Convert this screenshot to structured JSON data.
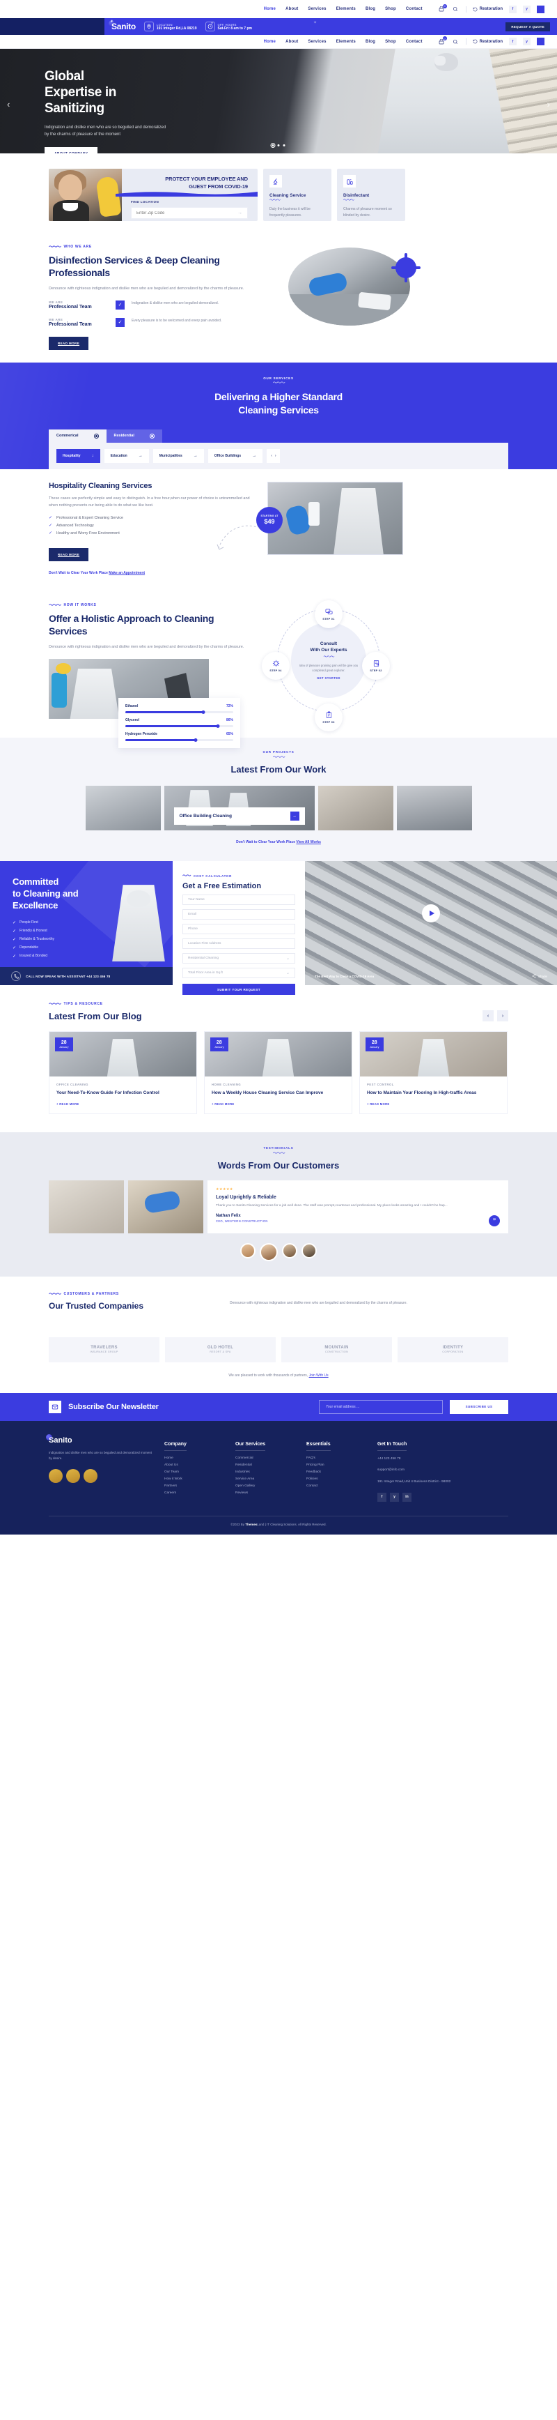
{
  "topbar": {
    "nav": [
      "Home",
      "About",
      "Services",
      "Elements",
      "Blog",
      "Shop",
      "Contact"
    ],
    "active_nav": "Home",
    "cart_badge": "0",
    "restoration_label": "Restoration",
    "socials": [
      "f",
      "y",
      "o"
    ]
  },
  "header": {
    "brand": "Sanito",
    "location_label": "LOCATION",
    "location_value": "191 Integer Rd,LA 08219",
    "hours_label": "OFF. HOURS",
    "hours_value": "Sat-Fri: 8 am to 7 pm",
    "quote_button": "REQUEST A QUOTE"
  },
  "hero": {
    "title_line1": "Global",
    "title_line2": "Expertise in",
    "title_line3": "Sanitizing",
    "description": "Indignation and dislike men who are so beguiled and demoralized by the charms of pleasure of the moment",
    "button": "ABOUT COMPANY",
    "slide_count": 3,
    "active_slide": 1
  },
  "promo": {
    "headline_line1": "PROTECT YOUR EMPLOYEE AND",
    "headline_line2": "GUEST FROM COVID-19",
    "find_label": "FIND LOCATION",
    "zip_placeholder": "Enter Zip Code",
    "zip_value": "",
    "cards": [
      {
        "title": "Cleaning Service",
        "desc": "Duty the business it will be frequently pleasures.",
        "icon": "broom-icon"
      },
      {
        "title": "Disinfectant",
        "desc": "Charms of pleasure moment so blinded by desire.",
        "icon": "spray-icon"
      }
    ]
  },
  "who": {
    "eyebrow": "WHO WE ARE",
    "title": "Disinfection Services & Deep Cleaning Professionals",
    "description": "Denounce with righteous indignation and dislike men who are beguiled and demoralized by the charms of pleasure.",
    "features": [
      {
        "label": "WE ARE",
        "value": "Professional Team",
        "text": "Indignation & dislike men who are beguiled demoralized."
      },
      {
        "label": "WE ARE",
        "value": "Professional Team",
        "text": "Every pleasure is to be welcomed and every pain avoided."
      }
    ],
    "button": "READ MORE"
  },
  "services": {
    "eyebrow": "OUR SERVICES",
    "title_line1": "Delivering a Higher Standard",
    "title_line2": "Cleaning Services",
    "tabs": [
      {
        "label": "Commerical",
        "active": true
      },
      {
        "label": "Residential",
        "active": false
      }
    ],
    "categories": [
      {
        "label": "Hospitality",
        "active": true,
        "arrow": "↓"
      },
      {
        "label": "Education",
        "active": false,
        "arrow": "→"
      },
      {
        "label": "Municipalities",
        "active": false,
        "arrow": "→"
      },
      {
        "label": "Office Buildings",
        "active": false,
        "arrow": "→"
      }
    ]
  },
  "hospitality": {
    "title": "Hospitality Cleaning Services",
    "description": "These cases are perfectly simple and easy to distinguish. In a free hour,when our power of choice is untrammelled and when nothing prevents our being able to do what we like best.",
    "checks": [
      "Professional & Expert Cleaning Service",
      "Advanced Technology",
      "Healthy and Worry Free Environment"
    ],
    "button": "READ MORE",
    "note_prefix": "Don't Wait to Clear Your Work Place ",
    "note_link": "Make an Appointment",
    "price_small": "STARTING AT",
    "price_value": "$49"
  },
  "how": {
    "eyebrow": "HOW IT WORKS",
    "title": "Offer a Holistic Approach to Cleaning Services",
    "description": "Denounce with righteous indignation and dislike men who are beguiled and demoralized by the charms of pleasure.",
    "bars": [
      {
        "name": "Ethanol",
        "percent": 72
      },
      {
        "name": "Glycerol",
        "percent": 86
      },
      {
        "name": "Hydrogen Peroxide",
        "percent": 65
      }
    ],
    "center_title_line1": "Consult",
    "center_title_line2": "With Our Experts",
    "center_desc": "Idea of pleasure praising pain will be give you completed great explorer.",
    "center_button": "GET STARTED",
    "steps": [
      {
        "label": "STEP 01",
        "icon": "chat-icon"
      },
      {
        "label": "STEP 02",
        "icon": "invoice-icon"
      },
      {
        "label": "STEP 03",
        "icon": "clipboard-icon"
      },
      {
        "label": "STEP 04",
        "icon": "virus-icon"
      }
    ]
  },
  "projects": {
    "eyebrow": "OUR PROJECTS",
    "title": "Latest From Our Work",
    "caption": "Office Building Cleaning",
    "note_prefix": "Don't Wait to Clear Your Work Place ",
    "note_link": "View All Works"
  },
  "estimation": {
    "left_title_line1": "Committed",
    "left_title_line2": "to Cleaning and",
    "left_title_line3": "Excellence",
    "bullets": [
      "People First",
      "Friendly & Honest",
      "Reliable & Trustworthy",
      "Dependable",
      "Insured & Bonded"
    ],
    "call_text": "CALL NOW SPEAK WITH ASSISTANT +44 123 456 78",
    "form_eyebrow": "COST CALCULATOR",
    "form_title": "Get a Free Estimation",
    "fields": [
      {
        "placeholder": "Your Name",
        "type": "text"
      },
      {
        "placeholder": "Email",
        "type": "text"
      },
      {
        "placeholder": "Phone",
        "type": "text"
      },
      {
        "placeholder": "Location First Address",
        "type": "text"
      },
      {
        "placeholder": "Residential Cleaning",
        "type": "select"
      },
      {
        "placeholder": "Total Floor Area in Sq.ft",
        "type": "select"
      }
    ],
    "submit": "SUBMIT YOUR REQUEST",
    "video_caption": "The Best Way to Clean a COVID-19 Area",
    "video_share": "Shade"
  },
  "blog": {
    "eyebrow": "TIPS & RESOURCE",
    "title": "Latest From Our Blog",
    "posts": [
      {
        "day": "28",
        "month": "January",
        "category": "OFFICE CLEANING",
        "title": "Your Need-To-Know Guide For Infection Control",
        "more": "READ MORE"
      },
      {
        "day": "28",
        "month": "January",
        "category": "HOME CLEANING",
        "title": "How a Weekly House Cleaning Service Can Improve",
        "more": "READ MORE"
      },
      {
        "day": "28",
        "month": "January",
        "category": "PEST CONTROL",
        "title": "How to Maintain Your Flooring In High-traffic Areas",
        "more": "READ MORE"
      }
    ]
  },
  "testimonials": {
    "eyebrow": "TESTIMONIALS",
    "title": "Words From Our Customers",
    "stars": "★★★★★",
    "quote_title": "Loyal Uprightly & Reliable",
    "quote_body": "Thank you to Sanito Cleaning Services for a job well done. The staff was prompt,courteous and professional. My place looks amazing and I couldn't be hap...",
    "author": "Nathan Felix",
    "author_role": "CEO, WESTERN CONSTRUCTION"
  },
  "partners": {
    "eyebrow": "CUSTOMERS & PARTNERS",
    "title": "Our Trusted Companies",
    "description": "Denounce with righteous indignation and dislike men who are beguiled and demoralized by the charms of pleasure.",
    "logos": [
      {
        "name": "TRAVELERS",
        "sub": "INSURANCE GROUP"
      },
      {
        "name": "GLD HOTEL",
        "sub": "RESORT & SPA"
      },
      {
        "name": "MOUNTAIN",
        "sub": "CONSTRUCTION"
      },
      {
        "name": "IDENTITY",
        "sub": "CORPORATION"
      }
    ],
    "note_prefix": "We are pleased to work with thousands of partners, ",
    "note_link": "Join With Us"
  },
  "newsletter": {
    "title": "Subscribe Our Newsletter",
    "placeholder": "Your email address ...",
    "button": "SUBSCRIBE US"
  },
  "footer": {
    "brand": "Sanito",
    "about": "Indignation and dislike men who are so beguiled and demoralized moment by desire.",
    "columns": [
      {
        "heading": "Company",
        "items": [
          "Home",
          "About Us",
          "Our Team",
          "How it Work",
          "Partners",
          "Careers"
        ]
      },
      {
        "heading": "Our Services",
        "items": [
          "Commercial",
          "Residential",
          "Industries",
          "Service Area",
          "Open Gallery",
          "Reviews"
        ]
      },
      {
        "heading": "Essentials",
        "items": [
          "FAQ's",
          "Pricing Plan",
          "Feedback",
          "Policies",
          "Contact"
        ]
      }
    ],
    "touch_heading": "Get In Touch",
    "touch_phone": "+44 123 456 78",
    "touch_email": "support@info.com",
    "touch_address": "191 Integer Road,Unit 4 Business District - 98002",
    "socials": [
      "f",
      "y",
      "in"
    ],
    "copyright_prefix": "©2023 By ",
    "copyright_brand": "Themes",
    "copyright_suffix": "Land | IT Cleaning Solutions. All Rights Reserved."
  },
  "colors": {
    "brand_blue": "#3b3ce0",
    "dark_navy": "#16225c",
    "header_navy": "#1b2a6b",
    "light_bg": "#f4f5fa"
  }
}
